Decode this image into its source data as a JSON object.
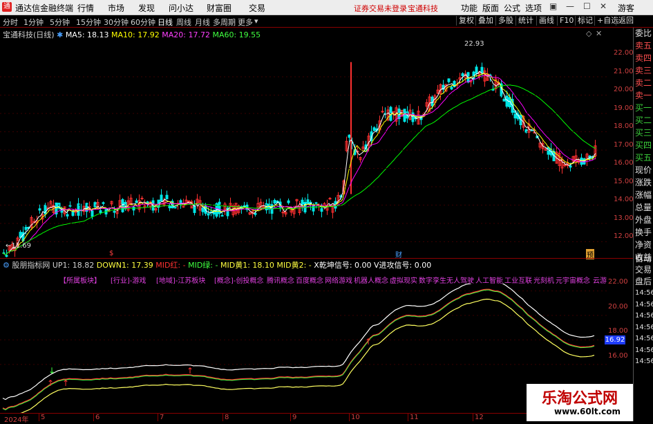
{
  "titlebar": {
    "app_title": "通达信金融终端",
    "menus": [
      "行情",
      "市场",
      "发现",
      "问小达",
      "财富圈",
      "交易"
    ],
    "notice": "证券交易未登录",
    "stock_name": "宝通科技",
    "right_menus": [
      "功能",
      "版面",
      "公式",
      "选项"
    ],
    "guest": "游客"
  },
  "periodbar": {
    "items": [
      "分时",
      "1分钟",
      "5分钟",
      "15分钟",
      "30分钟",
      "60分钟",
      "日线",
      "周线",
      "月线",
      "多周期",
      "更多"
    ],
    "active": "日线",
    "right_items": [
      "复权",
      "叠加",
      "多股",
      "统计",
      "画线",
      "F10",
      "标记",
      "+自选",
      "返回"
    ]
  },
  "main_legend": {
    "stock": "宝通科技(日线)",
    "ma5": "MA5: 18.13",
    "ma10": "MA10: 17.92",
    "ma20": "MA20: 17.72",
    "ma60": "MA60: 19.55"
  },
  "main_axis": {
    "ticks": [
      "22.00",
      "21.00",
      "20.00",
      "19.00",
      "18.00",
      "17.00",
      "16.00",
      "15.00",
      "14.00",
      "13.00",
      "12.00"
    ],
    "high_label": "22.93",
    "low_label": "11.69",
    "markers": [
      "$",
      "财",
      "预"
    ]
  },
  "right_column": {
    "items": [
      "委比",
      "卖五",
      "卖四",
      "卖三",
      "卖二",
      "卖一",
      "买一",
      "买二",
      "买三",
      "买四",
      "买五",
      "现价",
      "涨跌",
      "涨幅",
      "总量",
      "外盘",
      "换手",
      "净资",
      "收益",
      "自动",
      "交易",
      "盘后",
      "14:56",
      "14:56",
      "14:56",
      "14:56",
      "14:56",
      "14:56",
      "14:56"
    ]
  },
  "sub_legend": {
    "name": "股朋指标网",
    "up1": "UP1: 18.82",
    "down1": "DOWN1: 17.39",
    "mid_red": "MID红: -",
    "mid_green": "MID绿: -",
    "mid_yellow1": "MID黄1: 18.10",
    "mid_yellow2": "MID黄2: -",
    "qiankun": "X乾坤信号: 0.00",
    "jingong": "V进攻信号: 0.00"
  },
  "tags": [
    "【所属板块】",
    "[行业]-游戏",
    "[地域]-江苏板块",
    "[概念]-创投概念",
    "腾讯概念",
    "百度概念",
    "网络游戏",
    "机器人概念",
    "虚拟现实",
    "数字孪生",
    "无人驾驶",
    "人工智能",
    "工业互联",
    "光刻机",
    "元宇宙概念",
    "云游戏"
  ],
  "sub_axis": {
    "ticks": [
      "22.00",
      "20.00",
      "18.00",
      "16.00"
    ],
    "current": "16.92"
  },
  "time_axis": {
    "labels": [
      "2024年",
      "5",
      "6",
      "7",
      "8",
      "9",
      "10",
      "11",
      "12"
    ]
  },
  "watermark": {
    "title": "乐淘公式网",
    "url": "www.60lt.com"
  },
  "colors": {
    "up": "#ff3030",
    "down": "#00ffff",
    "ma5": "#ffffff",
    "ma10": "#ffff00",
    "ma20": "#ff00ff",
    "ma60": "#00ff00"
  }
}
